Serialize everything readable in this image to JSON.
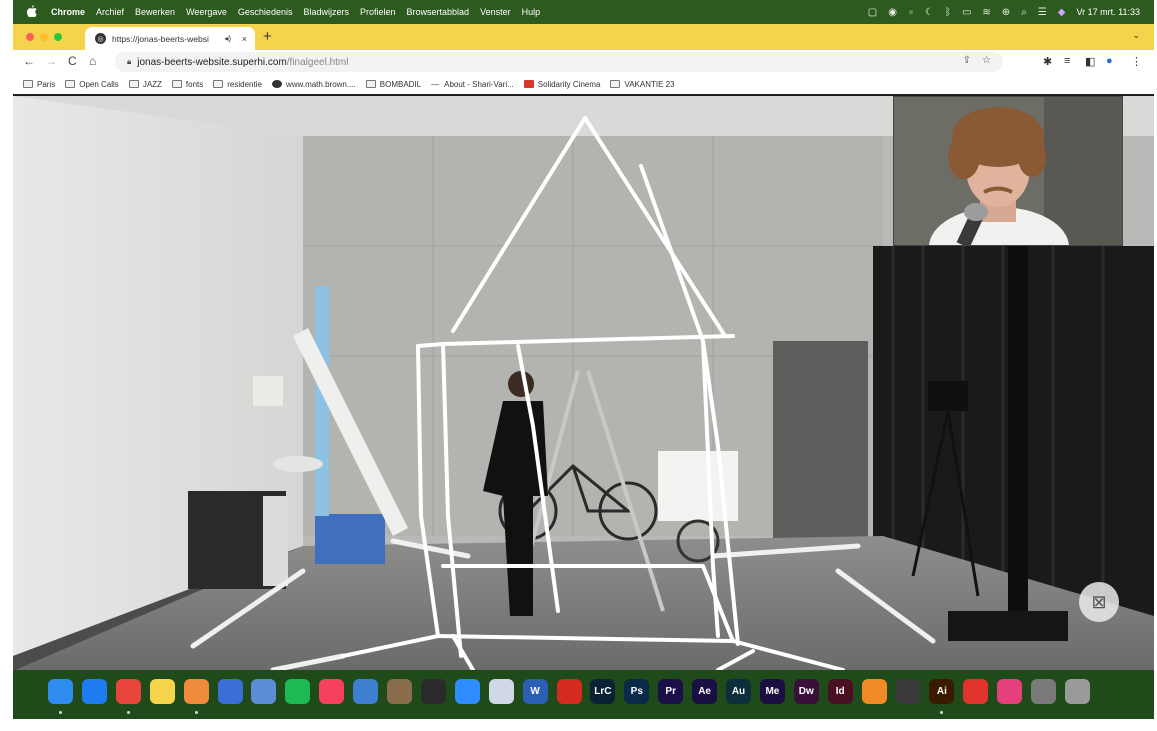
{
  "menubar": {
    "app_name": "Chrome",
    "items": [
      "Archief",
      "Bewerken",
      "Weergave",
      "Geschiedenis",
      "Bladwijzers",
      "Profielen",
      "Browsertabblad",
      "Venster",
      "Hulp"
    ],
    "status_icons": [
      "window-icon",
      "circle-icon",
      "moon-icon",
      "bluetooth-icon",
      "battery-icon",
      "wifi-icon",
      "user-icon",
      "search-icon",
      "control-center-icon",
      "siri-icon"
    ],
    "clock": "Vr 17 mrt. 11:33"
  },
  "tab": {
    "title": "https://jonas-beerts-websi",
    "close": "×",
    "new_tab": "+"
  },
  "address": {
    "host": "jonas-beerts-website.superhi.com",
    "path": "/finalgeel.html"
  },
  "bookmarks": [
    {
      "label": "Paris",
      "icon": "folder-icon"
    },
    {
      "label": "Open Calls",
      "icon": "folder-icon"
    },
    {
      "label": "JAZZ",
      "icon": "folder-icon"
    },
    {
      "label": "fonts",
      "icon": "folder-icon"
    },
    {
      "label": "residentie",
      "icon": "folder-icon"
    },
    {
      "label": "www.math.brown....",
      "icon": "globe-icon"
    },
    {
      "label": "BOMBADIL",
      "icon": "folder-icon"
    },
    {
      "label": "About - Shari-Vari...",
      "icon": "dash-icon"
    },
    {
      "label": "Solidarity Cinema",
      "icon": "red-s-icon"
    },
    {
      "label": "VAKANTIE 23",
      "icon": "folder-icon"
    }
  ],
  "dock": [
    {
      "name": "Finder",
      "label": "",
      "color": "#2f8df0"
    },
    {
      "name": "Safari",
      "label": "",
      "color": "#1e7cf0"
    },
    {
      "name": "Chrome",
      "label": "",
      "color": "#e8453c"
    },
    {
      "name": "Notes",
      "label": "",
      "color": "#f6d54c"
    },
    {
      "name": "Photos",
      "label": "",
      "color": "#f08b3c"
    },
    {
      "name": "QuickTime",
      "label": "",
      "color": "#3b6fd6"
    },
    {
      "name": "Preview",
      "label": "",
      "color": "#5c8ed8"
    },
    {
      "name": "Spotify",
      "label": "",
      "color": "#1db954"
    },
    {
      "name": "Music",
      "label": "",
      "color": "#f6415e"
    },
    {
      "name": "Cyberduck",
      "label": "",
      "color": "#3f7fd0"
    },
    {
      "name": "Instruments",
      "label": "",
      "color": "#8a6d4d"
    },
    {
      "name": "Logic",
      "label": "",
      "color": "#2a2a2a"
    },
    {
      "name": "Zoom",
      "label": "",
      "color": "#2d8cff"
    },
    {
      "name": "App",
      "label": "",
      "color": "#d0d8e8"
    },
    {
      "name": "Word",
      "label": "W",
      "color": "#2b5fb4"
    },
    {
      "name": "Acrobat",
      "label": "",
      "color": "#d42a1f"
    },
    {
      "name": "Lightroom Classic",
      "label": "LrC",
      "color": "#0b2134"
    },
    {
      "name": "Photoshop",
      "label": "Ps",
      "color": "#0a2a4a"
    },
    {
      "name": "Premiere",
      "label": "Pr",
      "color": "#1b0f4a"
    },
    {
      "name": "After Effects",
      "label": "Ae",
      "color": "#1a0f42"
    },
    {
      "name": "Audition",
      "label": "Au",
      "color": "#0d2e3a"
    },
    {
      "name": "Media Encoder",
      "label": "Me",
      "color": "#1a0f40"
    },
    {
      "name": "Dreamweaver",
      "label": "Dw",
      "color": "#3a0f38"
    },
    {
      "name": "InDesign",
      "label": "Id",
      "color": "#4a0f22"
    },
    {
      "name": "Blender",
      "label": "",
      "color": "#f08a24"
    },
    {
      "name": "Aperture",
      "label": "",
      "color": "#3a3a3a"
    },
    {
      "name": "Illustrator",
      "label": "Ai",
      "color": "#3a1a00"
    },
    {
      "name": "Acrobat Reader",
      "label": "",
      "color": "#e0332c"
    },
    {
      "name": "Creative Cloud",
      "label": "",
      "color": "#e5407b"
    },
    {
      "name": "Calculator",
      "label": "",
      "color": "#7a7a7a"
    },
    {
      "name": "Trash",
      "label": "",
      "color": "#9a9a9a"
    }
  ],
  "colors": {
    "menubar": "#2d5a1e",
    "tabstrip": "#f5d34a",
    "dock": "#1f4a1a",
    "traffic_close": "#ff5f57",
    "traffic_min": "#febc2e",
    "traffic_max": "#28c840"
  }
}
